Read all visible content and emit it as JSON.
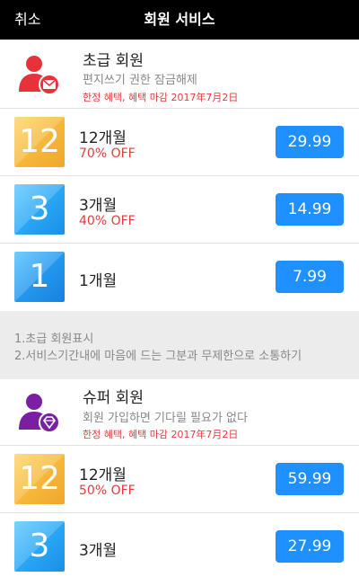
{
  "nav": {
    "cancel_label": "취소",
    "title": "회원 서비스"
  },
  "tiers": [
    {
      "title": "초급 회원",
      "description": "편지쓰기 권한 잠금해제",
      "promo": "한정 혜택, 혜택 마감 2017年7月2日",
      "icon": "user-mail-icon",
      "icon_color": "#e8323a",
      "plans": [
        {
          "badge": "12",
          "name": "12개월",
          "discount": "70% OFF",
          "price": "29.99"
        },
        {
          "badge": "3",
          "name": "3개월",
          "discount": "40% OFF",
          "price": "14.99"
        },
        {
          "badge": "1",
          "name": "1개월",
          "discount": "",
          "price": "7.99"
        }
      ]
    },
    {
      "title": "슈퍼 회원",
      "description": "회원 가입하면 기다릴 필요가 없다",
      "promo": "한정 혜택, 혜택 마감 2017年7月2日",
      "icon": "user-diamond-icon",
      "icon_color": "#7b1fa2",
      "plans": [
        {
          "badge": "12",
          "name": "12개월",
          "discount": "50% OFF",
          "price": "59.99"
        },
        {
          "badge": "3",
          "name": "3개월",
          "discount": "",
          "price": "27.99"
        }
      ]
    }
  ],
  "notes": [
    "1.초급 회원표시",
    "2.서비스기간내에 마음에 드는 그분과 무제한으로 소통하기"
  ],
  "colors": {
    "accent_blue": "#1e90ff",
    "promo_red": "#e33b3b",
    "nav_bg": "#000000"
  }
}
